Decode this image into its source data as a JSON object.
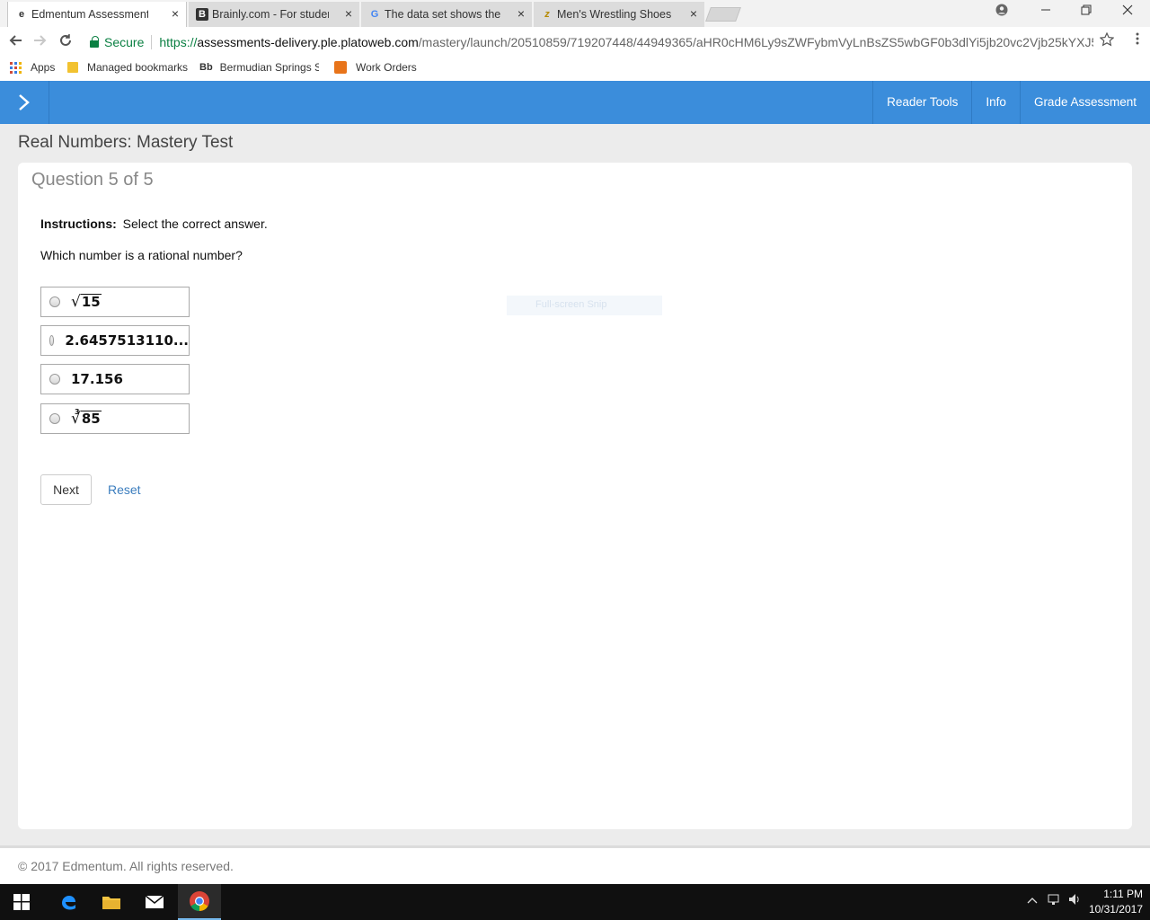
{
  "browser": {
    "tabs": [
      {
        "favicon": "e",
        "title": "Edmentum Assessments",
        "active": true
      },
      {
        "favicon": "B",
        "title": "Brainly.com - For students",
        "active": false
      },
      {
        "favicon": "G",
        "title": "The data set shows the m",
        "active": false
      },
      {
        "favicon": "z",
        "title": "Men's Wrestling Shoes N",
        "active": false
      }
    ],
    "close_glyph": "×",
    "address": {
      "secure_label": "Secure",
      "scheme": "https://",
      "host": "assessments-delivery.ple.platoweb.com",
      "path": "/mastery/launch/20510859/719207448/44949365/aHR0cHM6Ly9sZWFybmVyLnBsZS5wbGF0b3dlYi5jb20vc2Vjb25kYXJ5L5..."
    },
    "bookmarks": {
      "apps": "Apps",
      "managed": "Managed bookmarks",
      "bb_logo": "Bb",
      "bermudian": "Bermudian Springs S",
      "work_orders": "Work Orders"
    }
  },
  "app": {
    "nav": {
      "reader_tools": "Reader Tools",
      "info": "Info",
      "grade": "Grade Assessment"
    },
    "test_title": "Real Numbers: Mastery Test",
    "question_number": "Question 5 of 5",
    "instructions_label": "Instructions:",
    "instructions_text": "Select the correct answer.",
    "prompt": "Which number is a rational number?",
    "choices": [
      {
        "radicand": "15",
        "index": ""
      },
      {
        "text": "2.6457513110..."
      },
      {
        "text": "17.156"
      },
      {
        "radicand": "85",
        "index": "3"
      }
    ],
    "next_label": "Next",
    "reset_label": "Reset",
    "snip_overlay": "Full-screen Snip",
    "copyright": "© 2017 Edmentum. All rights reserved."
  },
  "taskbar": {
    "time": "1:11 PM",
    "date": "10/31/2017"
  },
  "colors": {
    "accent": "#3b8ddb",
    "secure_green": "#0b8043",
    "link_blue": "#3b7dbe"
  }
}
